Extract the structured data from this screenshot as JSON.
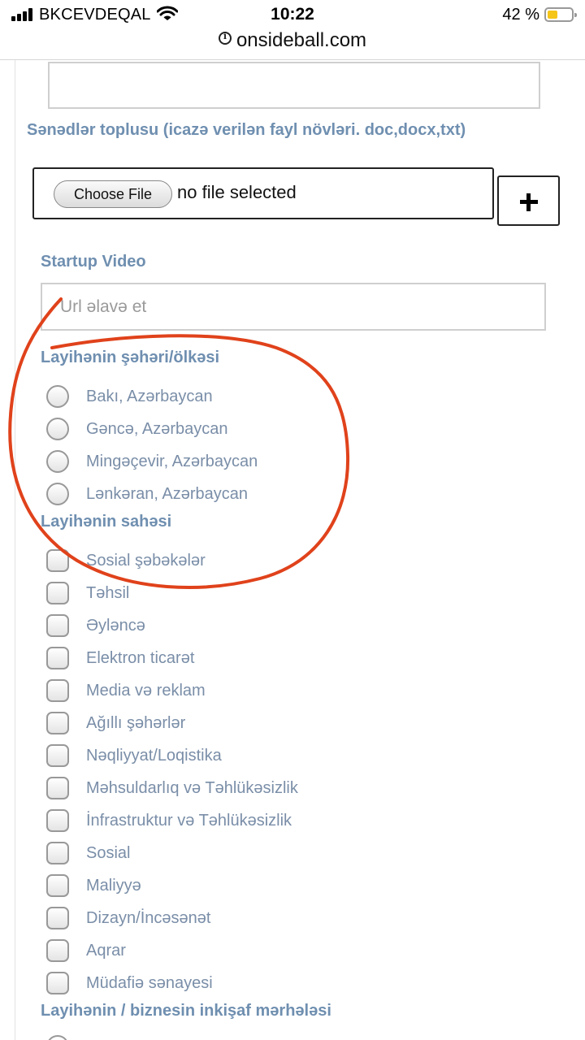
{
  "status": {
    "carrier": "BKCEVDEQAL",
    "time": "10:22",
    "battery": "42 %",
    "battery_color": "#f5c518"
  },
  "browser": {
    "url": "onsideball.com",
    "url_icon": "info-icon"
  },
  "form": {
    "docs_label": "Sənədlər toplusu (icazə verilən fayl növləri. doc,docx,txt)",
    "choose_file_label": "Choose File",
    "no_file_text": "no file selected",
    "add_icon": "plus-icon",
    "video_label": "Startup Video",
    "video_placeholder": "Url əlavə et",
    "city_label": "Layihənin şəhəri/ölkəsi",
    "cities": [
      "Bakı, Azərbaycan",
      "Gəncə, Azərbaycan",
      "Mingəçevir, Azərbaycan",
      "Lənkəran, Azərbaycan"
    ],
    "field_label": "Layihənin sahəsi",
    "fields": [
      "Sosial şəbəkələr",
      "Təhsil",
      "Əyləncə",
      "Elektron ticarət",
      "Media və reklam",
      "Ağıllı şəhərlər",
      "Nəqliyyat/Loqistika",
      "Məhsuldarlıq və Təhlükəsizlik",
      "İnfrastruktur və Təhlükəsizlik",
      "Sosial",
      "Maliyyə",
      "Dizayn/İncəsənət",
      "Aqrar",
      "Müdafiə sənayesi"
    ],
    "stage_label": "Layihənin / biznesin inkişaf mərhələsi"
  },
  "colors": {
    "label_blue": "#6f8fb0",
    "option_text": "#7a8ea8",
    "annotation_red": "#e0421b"
  }
}
